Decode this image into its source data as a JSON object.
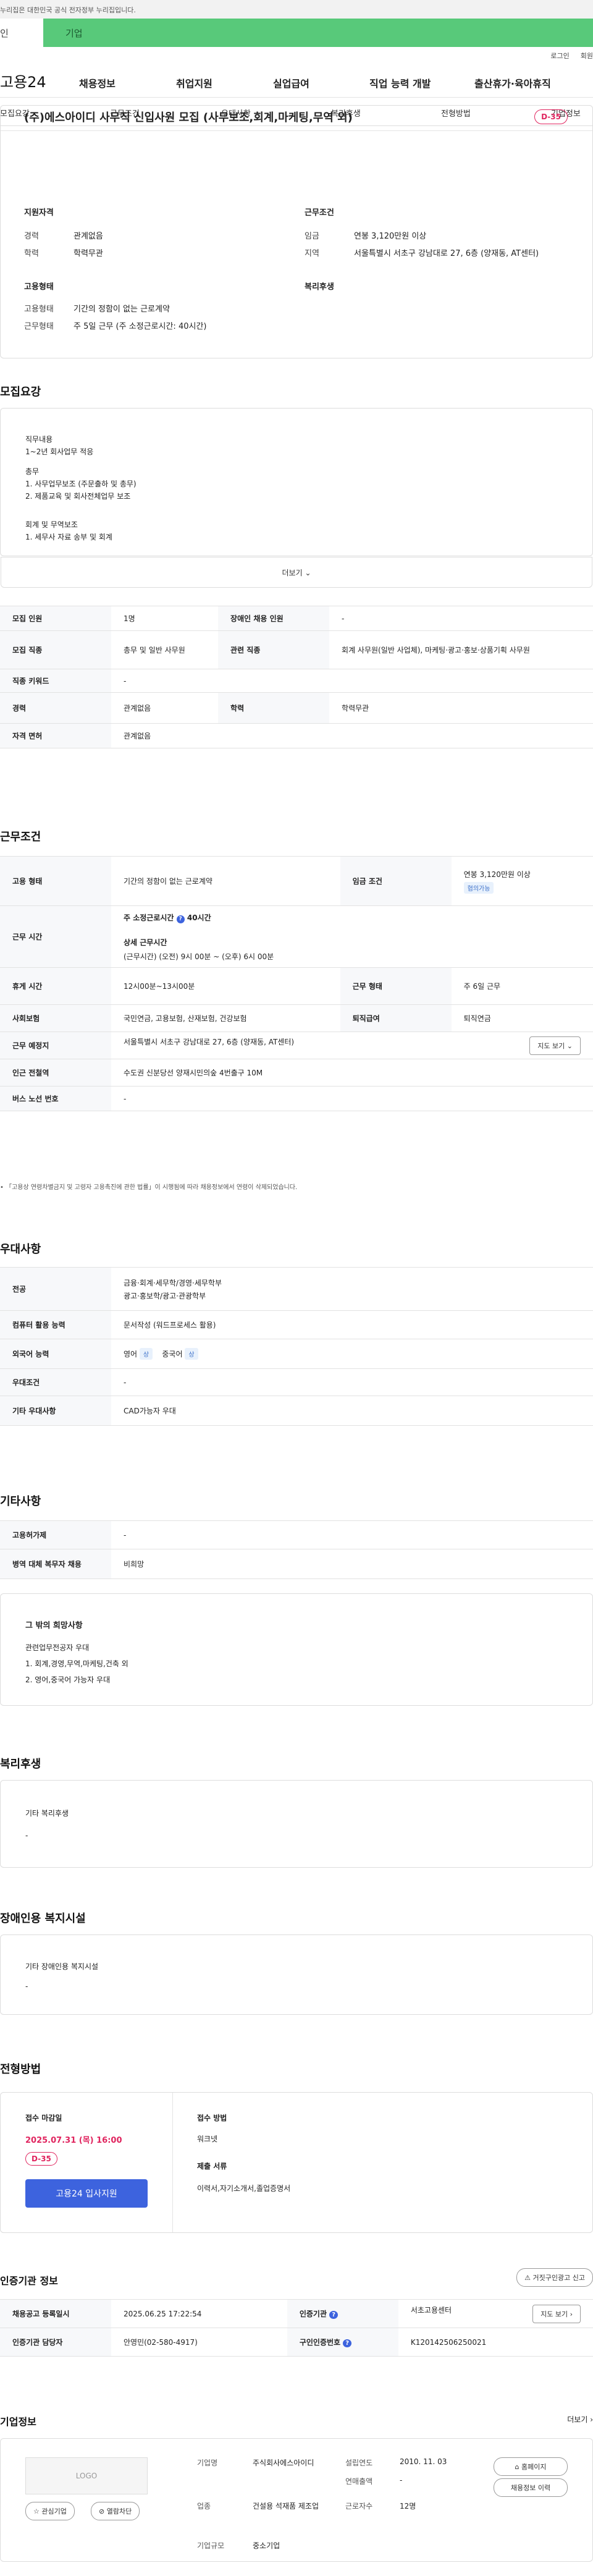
{
  "gov_banner": "누리집은 대한민국 공식 전자정부 누리집입니다.",
  "top_tabs": [
    "인",
    "기업"
  ],
  "util": [
    "로그인",
    "회원"
  ],
  "logo": "고용24",
  "gnb": [
    "채용정보",
    "취업지원",
    "실업급여",
    "직업 능력 개발",
    "출산휴가·육아휴직"
  ],
  "subnav": [
    "모집요강",
    "근무조건",
    "우대사항",
    "복리후생",
    "전형방법",
    "기업정보"
  ],
  "job": {
    "title": "(주)에스아이디 사무직 신입사원 모집 (사무보조,회계,마케팅,무역 외)",
    "dday": "D-35"
  },
  "summary": {
    "qual_h": "지원자격",
    "exp_l": "경력",
    "exp_v": "관계없음",
    "edu_l": "학력",
    "edu_v": "학력무관",
    "cond_h": "근무조건",
    "wage_l": "임금",
    "wage_v": "연봉 3,120만원 이상",
    "loc_l": "지역",
    "loc_v": "서울특별시 서초구 강남대로 27, 6층 (양재동, AT센터)",
    "emp_h": "고용형태",
    "emptype_l": "고용형태",
    "emptype_v": "기간의 정함이 없는 근로계약",
    "work_l": "근무형태",
    "work_v": "주 5일 근무 (주 소정근로시간: 40시간)",
    "welfare_h": "복리후생"
  },
  "recruit": {
    "h": "모집요강",
    "content": [
      "직무내용",
      "1~2년 회사업무 적응",
      "총무",
      "1. 사무업무보조 (주문출하 및 총무)",
      "2. 제품교육 및 회사전체업무 보조",
      "회계 및 무역보조",
      "1. 세무사 자료 송부 및 회계"
    ],
    "more": "더보기",
    "rows": [
      [
        "모집 인원",
        "1명",
        "장애인 채용 인원",
        "-"
      ],
      [
        "모집 직종",
        "총무 및 일반 사무원",
        "관련 직종",
        "회계 사무원(일반 사업체), 마케팅·광고·홍보·상품기획 사무원"
      ],
      [
        "직종 키워드",
        "-"
      ],
      [
        "경력",
        "관계없음",
        "학력",
        "학력무관"
      ],
      [
        "자격 면허",
        "관계없음"
      ]
    ]
  },
  "workcond": {
    "h": "근무조건",
    "emp_l": "고용 형태",
    "emp_v": "기간의 정함이 없는 근로계약",
    "wage_l": "임금 조건",
    "wage_v": "연봉 3,120만원 이상",
    "wage_chip": "협의가능",
    "time_l": "근무 시간",
    "hours_l": "주 소정근로시간",
    "hours_v": "40시간",
    "detail_l": "상세 근무시간",
    "detail_v": "(근무시간) (오전) 9시 00분 ~ (오후) 6시 00분",
    "rest_l": "휴게 시간",
    "rest_v": "12시00분~13시00분",
    "wtype_l": "근무 형태",
    "wtype_v": "주 6일 근무",
    "ins_l": "사회보험",
    "ins_v": "국민연금, 고용보험, 산재보험, 건강보험",
    "ret_l": "퇴직급여",
    "ret_v": "퇴직연금",
    "place_l": "근무 예정지",
    "place_v": "서울특별시 서초구 강남대로 27, 6층 (양재동, AT센터)",
    "map_btn": "지도 보기",
    "subway_l": "인근 전철역",
    "subway_v": "수도권 신분당선 양재시민의숲 4번출구 10M",
    "bus_l": "버스 노선 번호",
    "bus_v": "-",
    "note": "「고용상 연령차별금지 및 고령자 고용촉진에 관한 법률」이 시행됨에 따라 채용정보에서 연령이 삭제되었습니다."
  },
  "pref": {
    "h": "우대사항",
    "major_l": "전공",
    "major_v1": "금융·회계·세무학/경영·세무학부",
    "major_v2": "광고·홍보학/광고·관광학부",
    "comp_l": "컴퓨터 활용 능력",
    "comp_v": "문서작성 (워드프로세스 활용)",
    "lang_l": "외국어 능력",
    "lang_v1": "영어",
    "lang_v2": "중국어",
    "lang_chip": "상",
    "cond_l": "우대조건",
    "cond_v": "-",
    "etc_l": "기타 우대사항",
    "etc_v": "CAD가능자 우대"
  },
  "other": {
    "h": "기타사항",
    "emp_l": "고용허가제",
    "emp_v": "-",
    "mil_l": "병역 대체 복무자 채용",
    "mil_v": "비희망",
    "etc_h": "그 밖의 희망사항",
    "etc_v": [
      "관련업무전공자 우대",
      "1. 회계,경영,무역,마케팅,건축 외",
      "2. 영어,중국어 가능자 우대"
    ]
  },
  "welfare": {
    "h": "복리후생",
    "sub": "기타 복리후생",
    "v": "-"
  },
  "disab": {
    "h": "장애인용 복지시설",
    "sub": "기타 장애인용 복지시설",
    "v": "-"
  },
  "selection": {
    "h": "전형방법",
    "deadline_l": "접수 마감일",
    "deadline_v": "2025.07.31 (목) 16:00",
    "dday": "D-35",
    "apply": "고용24 입사지원",
    "method_l": "접수 방법",
    "method_v": "워크넷",
    "docs_l": "제출 서류",
    "docs_v": "이력서,자기소개서,졸업증명서"
  },
  "cert": {
    "h": "인증기관 정보",
    "report_btn": "거짓구인광고 신고",
    "reg_l": "채용공고 등록일시",
    "reg_v": "2025.06.25 17:22:54",
    "org_l": "인증기관",
    "org_v": "서초고용센터",
    "map_btn": "지도 보기",
    "mgr_l": "인증기관 담당자",
    "mgr_v": "안영민(02-580-4917)",
    "no_l": "구인인증번호",
    "no_v": "K120142506250021"
  },
  "company": {
    "h": "기업정보",
    "more": "더보기",
    "logo": "LOGO",
    "fav": "관심기업",
    "block": "열람차단",
    "name_l": "기업명",
    "name_v": "주식회사에스아이디",
    "est_l": "설립연도",
    "est_v": "2010. 11. 03",
    "sales_l": "연매출액",
    "sales_v": "-",
    "ind_l": "업종",
    "ind_v": "건설용 석재품 제조업",
    "emp_l": "근로자수",
    "emp_v": "12명",
    "size_l": "기업규모",
    "size_v": "중소기업",
    "home_btn": "홈페이지",
    "jobs_btn": "채용정보 이력"
  },
  "colors": {
    "accent": "#3d63de",
    "green": "#58c97a",
    "red": "#e0245e"
  }
}
